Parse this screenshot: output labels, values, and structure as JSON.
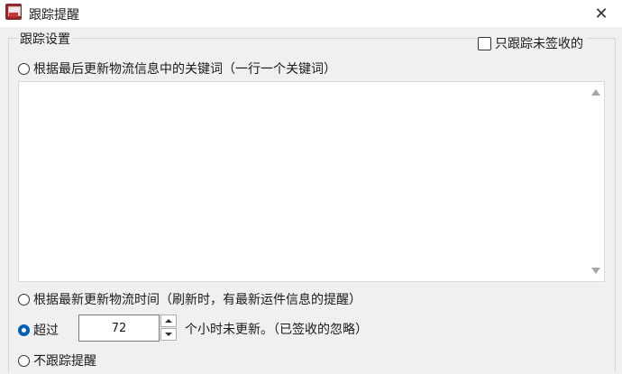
{
  "window": {
    "title": "跟踪提醒",
    "close_glyph": "✕",
    "icon": "app-icon"
  },
  "group": {
    "title": "跟踪设置",
    "only_unsigned_label": "只跟踪未签收的",
    "only_unsigned_checked": false
  },
  "options": {
    "keyword_label": "根据最后更新物流信息中的关键词（一行一个关键词）",
    "keyword_text": "",
    "time_label": "根据最新更新物流时间（刷新时，有最新运件信息的提醒）",
    "exceed_label": "超过",
    "hours_value": "72",
    "hours_suffix": "个小时未更新。（已签收的忽略）",
    "none_label": "不跟踪提醒",
    "selected": "exceed"
  }
}
